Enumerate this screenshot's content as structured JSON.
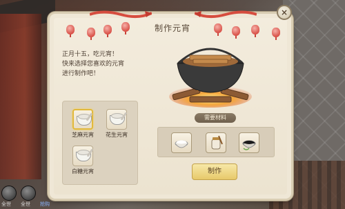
{
  "dialog": {
    "title": "制作元宵",
    "close_label": "×",
    "description": [
      "正月十五，吃元宵！",
      "快来选择您喜欢的元宵",
      "进行制作吧！"
    ]
  },
  "recipes": [
    {
      "name": "芝麻元宵",
      "selected": true,
      "icon": "sesame-yuanxiao-bowl-icon"
    },
    {
      "name": "花生元宵",
      "selected": false,
      "icon": "peanut-yuanxiao-bowl-icon"
    },
    {
      "name": "白糖元宵",
      "selected": false,
      "icon": "sugar-yuanxiao-bowl-icon"
    }
  ],
  "materials": {
    "label": "需要材料",
    "items": [
      {
        "icon": "rice-flour-bowl-icon"
      },
      {
        "icon": "sugar-jar-icon"
      },
      {
        "icon": "sesame-bowl-icon"
      }
    ]
  },
  "make_button": {
    "label": "制作"
  },
  "hud": {
    "left_text": "全世",
    "right_text": "全世",
    "link_text": "抢购"
  },
  "colors": {
    "accent": "#e2b93b",
    "panel": "#efe7d6",
    "button": "#e7c96a"
  }
}
